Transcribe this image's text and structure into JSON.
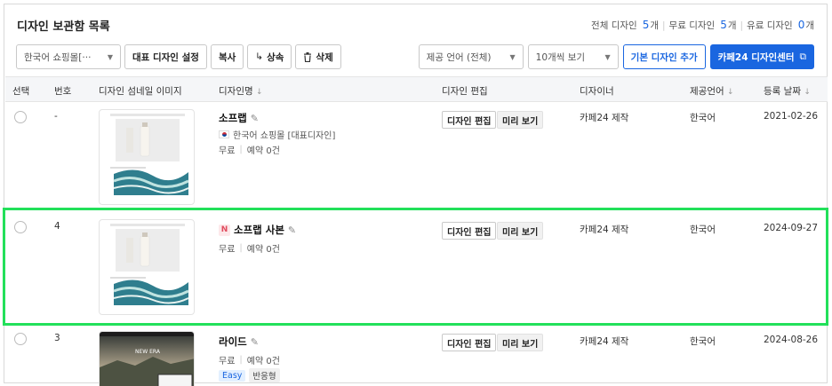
{
  "header": {
    "title": "디자인 보관함 목록",
    "counts": {
      "total_label": "전체 디자인",
      "total": "5",
      "total_unit": "개",
      "free_label": "무료 디자인",
      "free": "5",
      "free_unit": "개",
      "paid_label": "유료 디자인",
      "paid": "0",
      "paid_unit": "개"
    }
  },
  "toolbar": {
    "shop_select": "한국어 쇼핑몰[···",
    "set_main": "대표 디자인 설정",
    "copy": "복사",
    "inherit": "상속",
    "delete": "삭제",
    "lang_select": "제공 언어 (전체)",
    "page_size_select": "10개씩 보기",
    "add_basic": "기본 디자인 추가",
    "design_center": "카페24 디자인센터"
  },
  "table": {
    "columns": {
      "select": "선택",
      "number": "번호",
      "thumbnail": "디자인 섬네일 이미지",
      "name": "디자인명",
      "edit": "디자인 편집",
      "designer": "디자이너",
      "language": "제공언어",
      "date": "등록 날짜"
    },
    "edit_label": "디자인 편집",
    "preview_label": "미리 보기",
    "rows": [
      {
        "number": "-",
        "name": "소프랩",
        "shop": "한국어 쇼핑몰 [대표디자인]",
        "price": "무료",
        "reserve": "예약 0건",
        "designer": "카페24 제작",
        "language": "한국어",
        "date": "2021-02-26"
      },
      {
        "number": "4",
        "new_badge": "N",
        "name": "소프랩 사본",
        "price": "무료",
        "reserve": "예약 0건",
        "designer": "카페24 제작",
        "language": "한국어",
        "date": "2024-09-27"
      },
      {
        "number": "3",
        "name": "라이드",
        "price": "무료",
        "reserve": "예약 0건",
        "tag_easy": "Easy",
        "tag_responsive": "반응형",
        "designer": "카페24 제작",
        "language": "한국어",
        "date": "2024-08-26",
        "thumb_text": "NEW ERA"
      }
    ]
  },
  "colors": {
    "accent": "#1a66e0",
    "highlight": "#22e05a"
  }
}
